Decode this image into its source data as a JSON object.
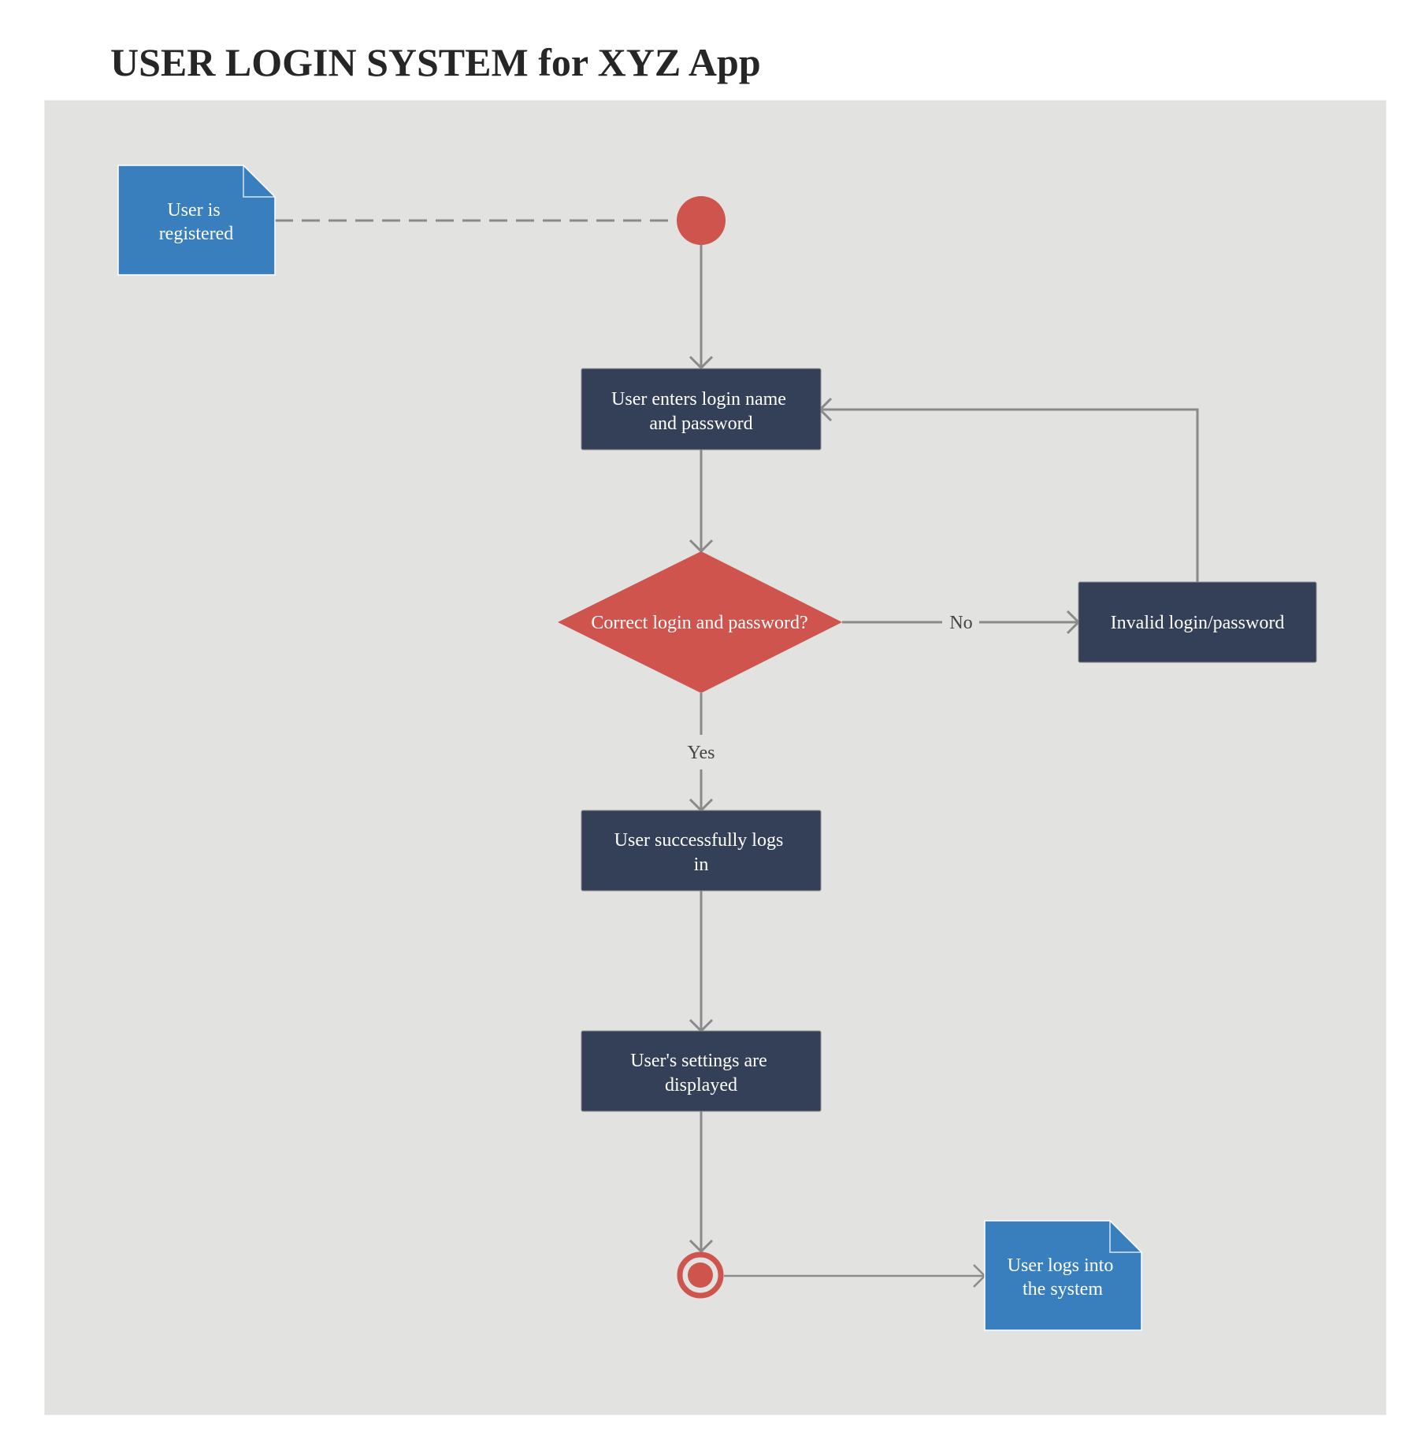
{
  "title": "USER LOGIN SYSTEM for XYZ App",
  "colors": {
    "canvas": "#e2e2e1",
    "action": "#344058",
    "decision": "#d0544e",
    "note": "#3a7fbd",
    "edge": "#8a8a8a",
    "label": "#444444"
  },
  "nodes": {
    "note_registered": {
      "type": "note",
      "lines": [
        "User is",
        "registered"
      ]
    },
    "start": {
      "type": "initial"
    },
    "enter_credentials": {
      "type": "action",
      "lines": [
        "User enters login name",
        "and password"
      ]
    },
    "decision": {
      "type": "decision",
      "lines": [
        "Correct login and password?"
      ]
    },
    "invalid": {
      "type": "action",
      "lines": [
        "Invalid login/password"
      ]
    },
    "success": {
      "type": "action",
      "lines": [
        "User successfully logs",
        "in"
      ]
    },
    "settings": {
      "type": "action",
      "lines": [
        "User's settings are",
        "displayed"
      ]
    },
    "end": {
      "type": "final"
    },
    "note_logged_in": {
      "type": "note",
      "lines": [
        "User logs into",
        "the system"
      ]
    }
  },
  "edges": [
    {
      "from": "note_registered",
      "to": "start",
      "style": "dashed",
      "label": ""
    },
    {
      "from": "start",
      "to": "enter_credentials",
      "style": "solid",
      "label": ""
    },
    {
      "from": "enter_credentials",
      "to": "decision",
      "style": "solid",
      "label": ""
    },
    {
      "from": "decision",
      "to": "invalid",
      "style": "solid",
      "label": "No"
    },
    {
      "from": "invalid",
      "to": "enter_credentials",
      "style": "solid",
      "label": ""
    },
    {
      "from": "decision",
      "to": "success",
      "style": "solid",
      "label": "Yes"
    },
    {
      "from": "success",
      "to": "settings",
      "style": "solid",
      "label": ""
    },
    {
      "from": "settings",
      "to": "end",
      "style": "solid",
      "label": ""
    },
    {
      "from": "end",
      "to": "note_logged_in",
      "style": "solid",
      "label": ""
    }
  ]
}
